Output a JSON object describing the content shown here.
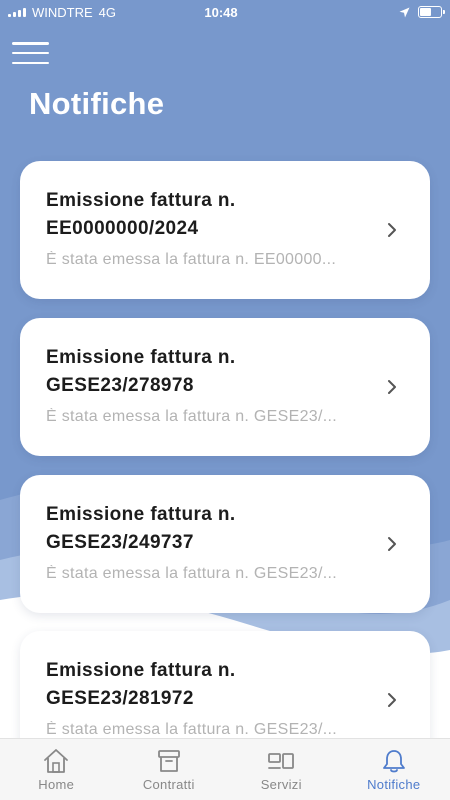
{
  "status_bar": {
    "carrier": "WINDTRE",
    "network": "4G",
    "time": "10:48"
  },
  "header": {
    "title": "Notifiche",
    "menu_icon": "hamburger-menu-icon"
  },
  "notifications": [
    {
      "title_line1": "Emissione fattura n.",
      "title_line2": "EE0000000/2024",
      "preview": "È stata emessa la fattura n. EE00000..."
    },
    {
      "title_line1": "Emissione fattura n.",
      "title_line2": "GESE23/278978",
      "preview": "È stata emessa la fattura n. GESE23/..."
    },
    {
      "title_line1": "Emissione fattura n.",
      "title_line2": "GESE23/249737",
      "preview": "È stata emessa la fattura n. GESE23/..."
    },
    {
      "title_line1": "Emissione fattura n.",
      "title_line2": "GESE23/281972",
      "preview": "È stata emessa la fattura n. GESE23/..."
    }
  ],
  "tabbar": {
    "tabs": [
      {
        "label": "Home",
        "icon": "home-icon"
      },
      {
        "label": "Contratti",
        "icon": "archive-box-icon"
      },
      {
        "label": "Servizi",
        "icon": "services-icon"
      },
      {
        "label": "Notifiche",
        "icon": "bell-icon",
        "active": true
      }
    ]
  },
  "colors": {
    "background": "#7898cc",
    "accent": "#4f7ccc",
    "card": "#ffffff"
  }
}
